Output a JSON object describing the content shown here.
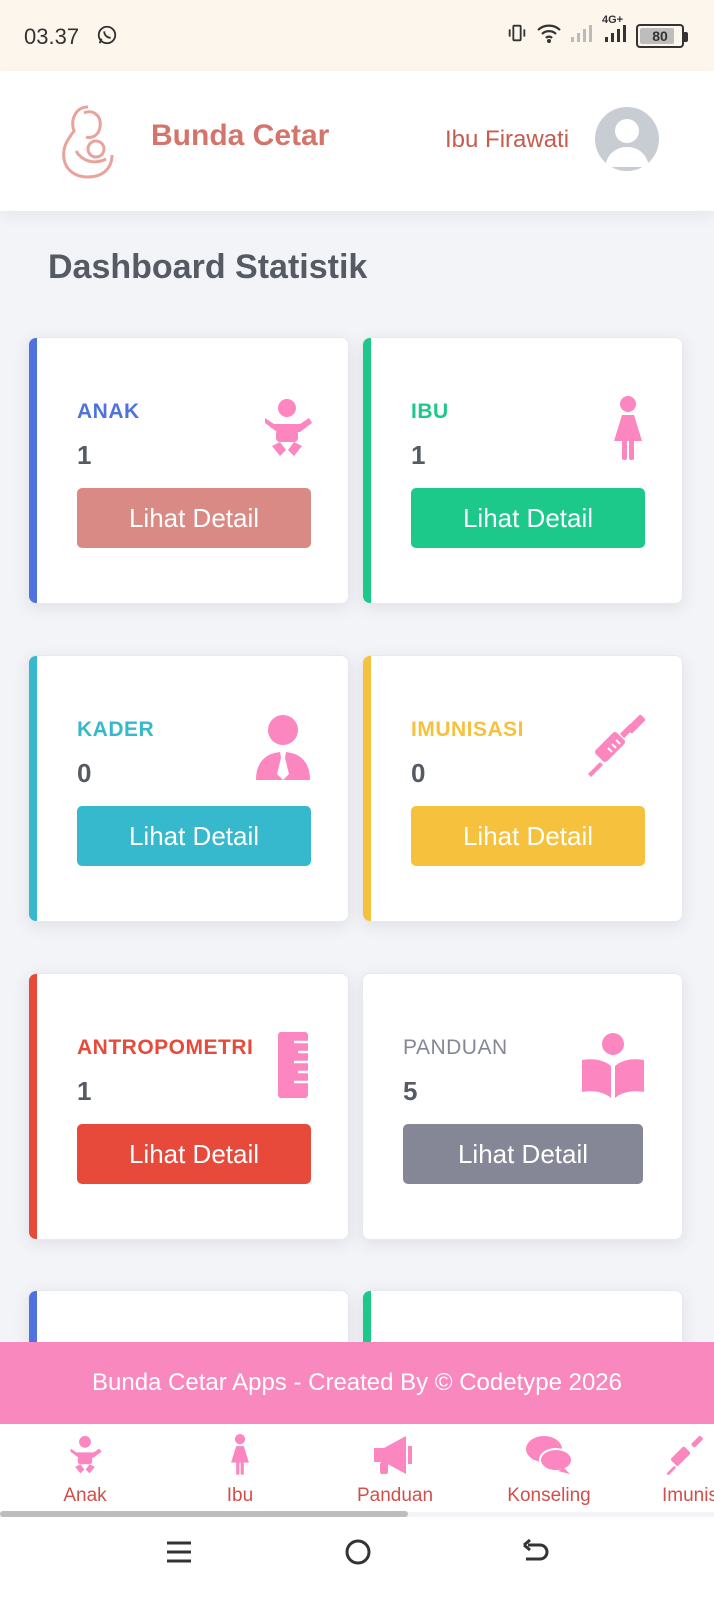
{
  "status_bar": {
    "time": "03.37",
    "network": "4G+",
    "battery": "80"
  },
  "header": {
    "brand": "Bunda Cetar",
    "user_name": "Ibu Firawati"
  },
  "page_title": "Dashboard Statistik",
  "cards": [
    {
      "label": "ANAK",
      "value": "1",
      "button": "Lihat Detail",
      "accent": "#4e73df",
      "button_color": "#d98a85",
      "icon": "baby-icon"
    },
    {
      "label": "IBU",
      "value": "1",
      "button": "Lihat Detail",
      "accent": "#1cc88a",
      "button_color": "#1cc88a",
      "icon": "woman-icon"
    },
    {
      "label": "KADER",
      "value": "0",
      "button": "Lihat Detail",
      "accent": "#36b9cc",
      "button_color": "#36b9cc",
      "icon": "user-tie-icon"
    },
    {
      "label": "IMUNISASI",
      "value": "0",
      "button": "Lihat Detail",
      "accent": "#f6c23e",
      "button_color": "#f6c23e",
      "icon": "syringe-icon"
    },
    {
      "label": "ANTROPOMETRI",
      "value": "1",
      "button": "Lihat Detail",
      "accent": "#e74a3b",
      "button_color": "#e74a3b",
      "icon": "ruler-icon"
    },
    {
      "label": "PANDUAN",
      "value": "5",
      "button": "Lihat Detail",
      "accent": "#858796",
      "button_color": "#858796",
      "icon": "reader-icon"
    }
  ],
  "footer": {
    "text": "Bunda Cetar Apps - Created By © Codetype 2026"
  },
  "bottom_nav": [
    {
      "label": "Anak",
      "icon": "baby-icon"
    },
    {
      "label": "Ibu",
      "icon": "woman-icon"
    },
    {
      "label": "Panduan",
      "icon": "megaphone-icon"
    },
    {
      "label": "Konseling",
      "icon": "comments-icon"
    },
    {
      "label": "Imunisasi",
      "icon": "syringe-icon"
    }
  ],
  "colors": {
    "brand": "#d4756b",
    "pink": "#f888bd",
    "icon_pink": "#fb86c0"
  }
}
